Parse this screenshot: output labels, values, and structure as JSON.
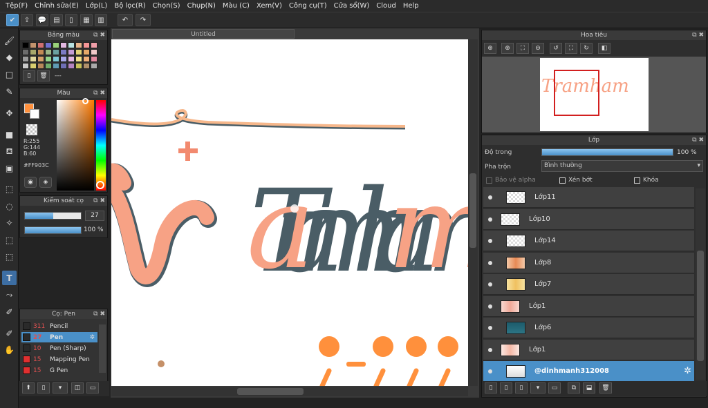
{
  "menu": [
    "Tệp(F)",
    "Chỉnh sửa(E)",
    "Lớp(L)",
    "Bộ lọc(R)",
    "Chọn(S)",
    "Chụp(N)",
    "Màu (C)",
    "Xem(V)",
    "Công cụ(T)",
    "Cửa sổ(W)",
    "Cloud",
    "Help"
  ],
  "swatch_panel": {
    "title": "Bảng màu",
    "label": "---"
  },
  "color_panel": {
    "title": "Màu",
    "r": "R:255",
    "g": "G:144",
    "b": "B:60",
    "hex": "#FF903C",
    "current_color": "#ff903c"
  },
  "brush_control": {
    "title": "Kiểm soát cọ",
    "size": "27",
    "opacity": "100 %",
    "size_fraction": 0.5,
    "opacity_fraction": 1.0
  },
  "brush_list": {
    "title": "Cọ: Pen",
    "items": [
      {
        "size": "311",
        "name": "Pencil",
        "color": "#2a2a2a"
      },
      {
        "size": "27",
        "name": "Pen",
        "color": "#2a2a2a"
      },
      {
        "size": "10",
        "name": "Pen (Sharp)",
        "color": "#2a2a2a"
      },
      {
        "size": "15",
        "name": "Mapping Pen",
        "color": "#e03030"
      },
      {
        "size": "15",
        "name": "G Pen",
        "color": "#e03030"
      }
    ]
  },
  "document": {
    "tab": "Untitled",
    "text": "Tramham"
  },
  "navigator": {
    "title": "Hoa tiêu",
    "preview_text": "Tramham"
  },
  "layer_panel": {
    "title": "Lớp",
    "opacity_label": "Độ trong",
    "opacity_value": "100 %",
    "opacity_fraction": 1.0,
    "blend_label": "Pha trộn",
    "blend_value": "Bình thường",
    "protect_alpha": "Bảo vệ alpha",
    "clip": "Xén bớt",
    "lock": "Khóa",
    "layers": [
      {
        "name": "Lớp11",
        "thumb": "checker"
      },
      {
        "name": "Lớp10",
        "thumb": "checker"
      },
      {
        "name": "Lớp14",
        "thumb": "checker"
      },
      {
        "name": "Lớp8",
        "thumb": "orange"
      },
      {
        "name": "Lớp7",
        "thumb": "yellow"
      },
      {
        "name": "Lớp1",
        "thumb": "pink"
      },
      {
        "name": "Lớp6",
        "thumb": "teal"
      },
      {
        "name": "Lớp1",
        "thumb": "pinklight"
      },
      {
        "name": "@dinhmanh312008",
        "thumb": "text"
      }
    ]
  }
}
